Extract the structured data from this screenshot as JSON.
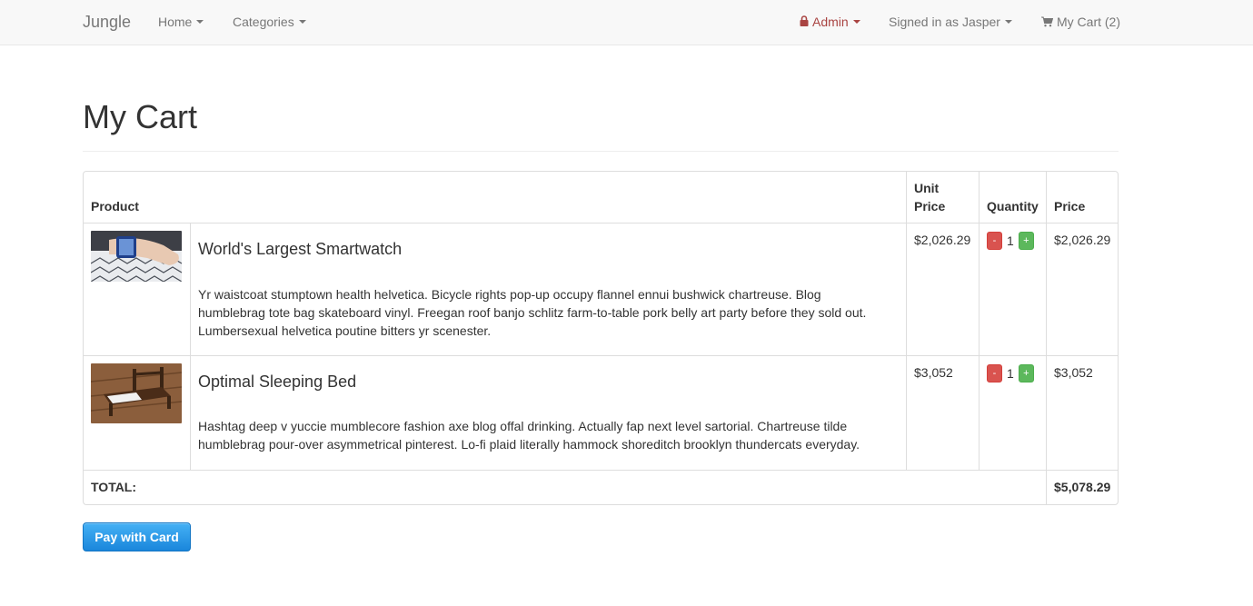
{
  "nav": {
    "brand": "Jungle",
    "home_label": "Home",
    "categories_label": "Categories",
    "admin_label": "Admin",
    "user_label": "Signed in as Jasper",
    "cart_label": "My Cart (2)",
    "admin_color": "#a94442"
  },
  "page": {
    "title": "My Cart"
  },
  "table": {
    "headers": {
      "product": "Product",
      "unit_price": "Unit Price",
      "quantity": "Quantity",
      "price": "Price"
    },
    "items": [
      {
        "name": "World's Largest Smartwatch",
        "description": "Yr waistcoat stumptown health helvetica. Bicycle rights pop-up occupy flannel ennui bushwick chartreuse. Blog humblebrag tote bag skateboard vinyl. Freegan roof banjo schlitz farm-to-table pork belly art party before they sold out. Lumbersexual helvetica poutine bitters yr scenester.",
        "unit_price": "$2,026.29",
        "quantity": "1",
        "price": "$2,026.29",
        "minus": "-",
        "plus": "+",
        "image_icon": "smartwatch-photo"
      },
      {
        "name": "Optimal Sleeping Bed",
        "description": "Hashtag deep v yuccie mumblecore fashion axe blog offal drinking. Actually fap next level sartorial. Chartreuse tilde humblebrag pour-over asymmetrical pinterest. Lo-fi plaid literally hammock shoreditch brooklyn thundercats everyday.",
        "unit_price": "$3,052",
        "quantity": "1",
        "price": "$3,052",
        "minus": "-",
        "plus": "+",
        "image_icon": "bed-photo"
      }
    ],
    "total_label": "TOTAL:",
    "total_value": "$5,078.29"
  },
  "pay_button": {
    "label": "Pay with Card"
  },
  "colors": {
    "minus_button": "#d9534f",
    "plus_button": "#5cb85c",
    "pay_button": "#1a86db"
  }
}
